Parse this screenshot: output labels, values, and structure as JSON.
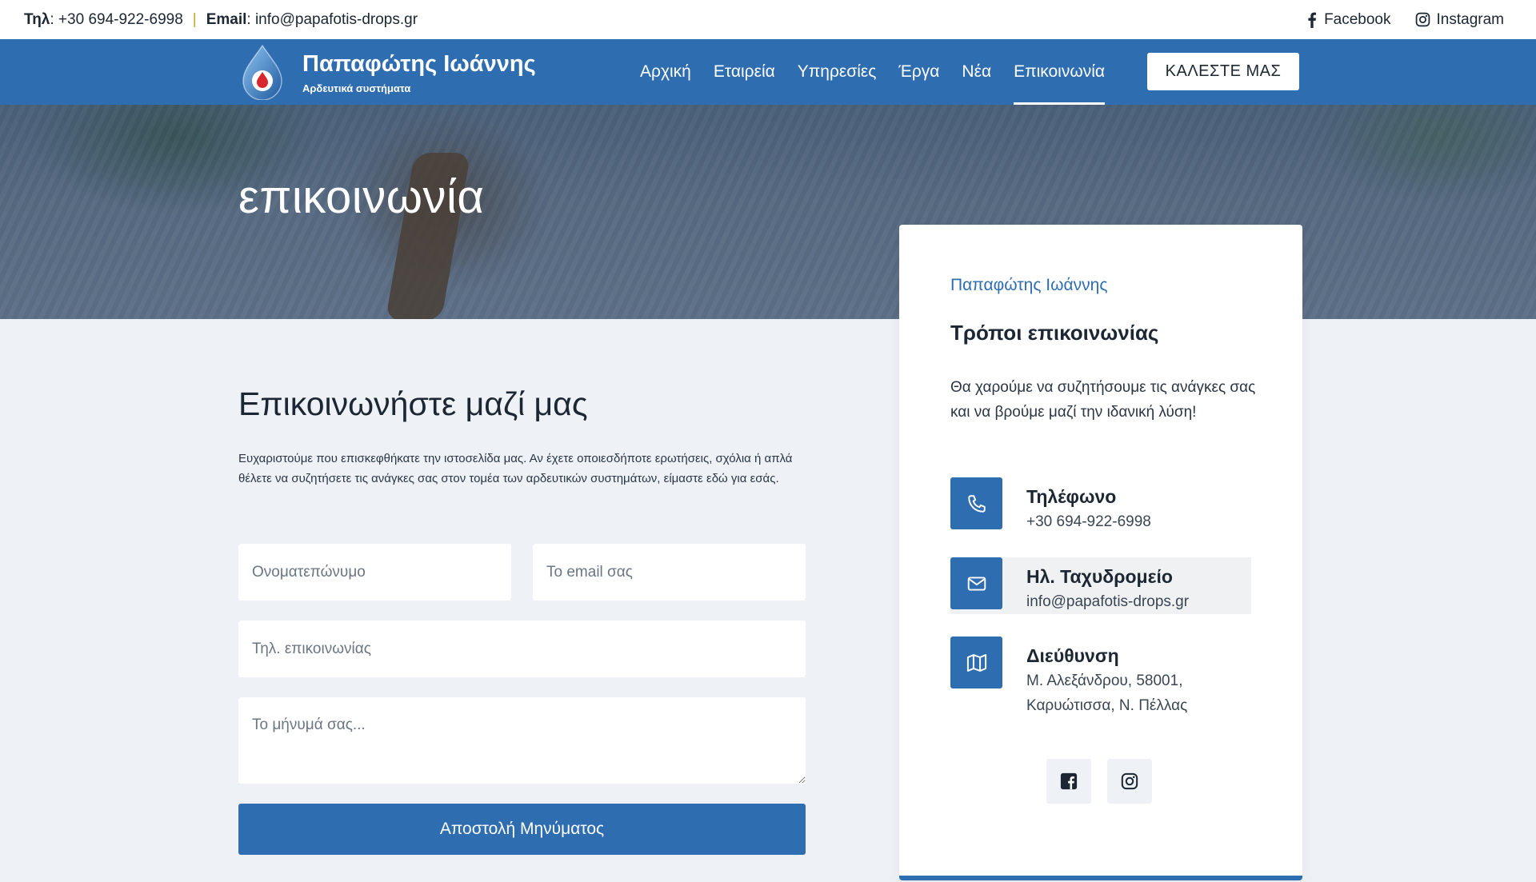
{
  "topbar": {
    "phone_label": "Τηλ",
    "phone": ": +30 694-922-6998",
    "separator": "|",
    "email_label": "Email",
    "email": ": info@papafotis-drops.gr",
    "facebook": "Facebook",
    "instagram": "Instagram"
  },
  "brand": {
    "name": "Παπαφώτης Ιωάννης",
    "tagline": "Αρδευτικά συστήματα"
  },
  "nav": {
    "items": [
      {
        "label": "Αρχική"
      },
      {
        "label": "Εταιρεία"
      },
      {
        "label": "Υπηρεσίες"
      },
      {
        "label": "Έργα"
      },
      {
        "label": "Νέα"
      },
      {
        "label": "Επικοινωνία"
      }
    ],
    "active_index": 5,
    "call_button": "ΚΑΛΕΣΤΕ ΜΑΣ"
  },
  "hero": {
    "title": "επικοινωνία"
  },
  "form": {
    "title": "Επικοινωνήστε μαζί μας",
    "intro": "Ευχαριστούμε που επισκεφθήκατε την ιστοσελίδα μας. Αν έχετε οποιεσδήποτε ερωτήσεις, σχόλια ή απλά θέλετε να συζητήσετε τις ανάγκες σας στον τομέα των αρδευτικών συστημάτων, είμαστε εδώ για εσάς.",
    "name_placeholder": "Ονοματεπώνυμο",
    "email_placeholder": "Το email σας",
    "phone_placeholder": "Τηλ. επικοινωνίας",
    "message_placeholder": "Το μήνυμά σας...",
    "submit_label": "Αποστολή Μηνύματος"
  },
  "card": {
    "kicker": "Παπαφώτης Ιωάννης",
    "title": "Τρόποι επικοινωνίας",
    "description": "Θα χαρούμε να συζητήσουμε τις ανάγκες σας και να βρούμε μαζί την ιδανική λύση!",
    "phone_label": "Τηλέφωνο",
    "phone_value": "+30 694-922-6998",
    "email_label": "Ηλ. Ταχυδρομείο",
    "email_value": "info@papafotis-drops.gr",
    "address_label": "Διεύθυνση",
    "address_value": "Μ. Αλεξάνδρου, 58001, Καρυώτισσα, Ν. Πέλλας"
  },
  "icons": {
    "phone": "phone-icon",
    "email": "mail-icon",
    "address": "map-icon",
    "facebook": "facebook-icon",
    "instagram": "instagram-icon"
  },
  "colors": {
    "primary": "#2f6db1",
    "page_background": "#eef1f6",
    "separator": "#c9a227"
  }
}
